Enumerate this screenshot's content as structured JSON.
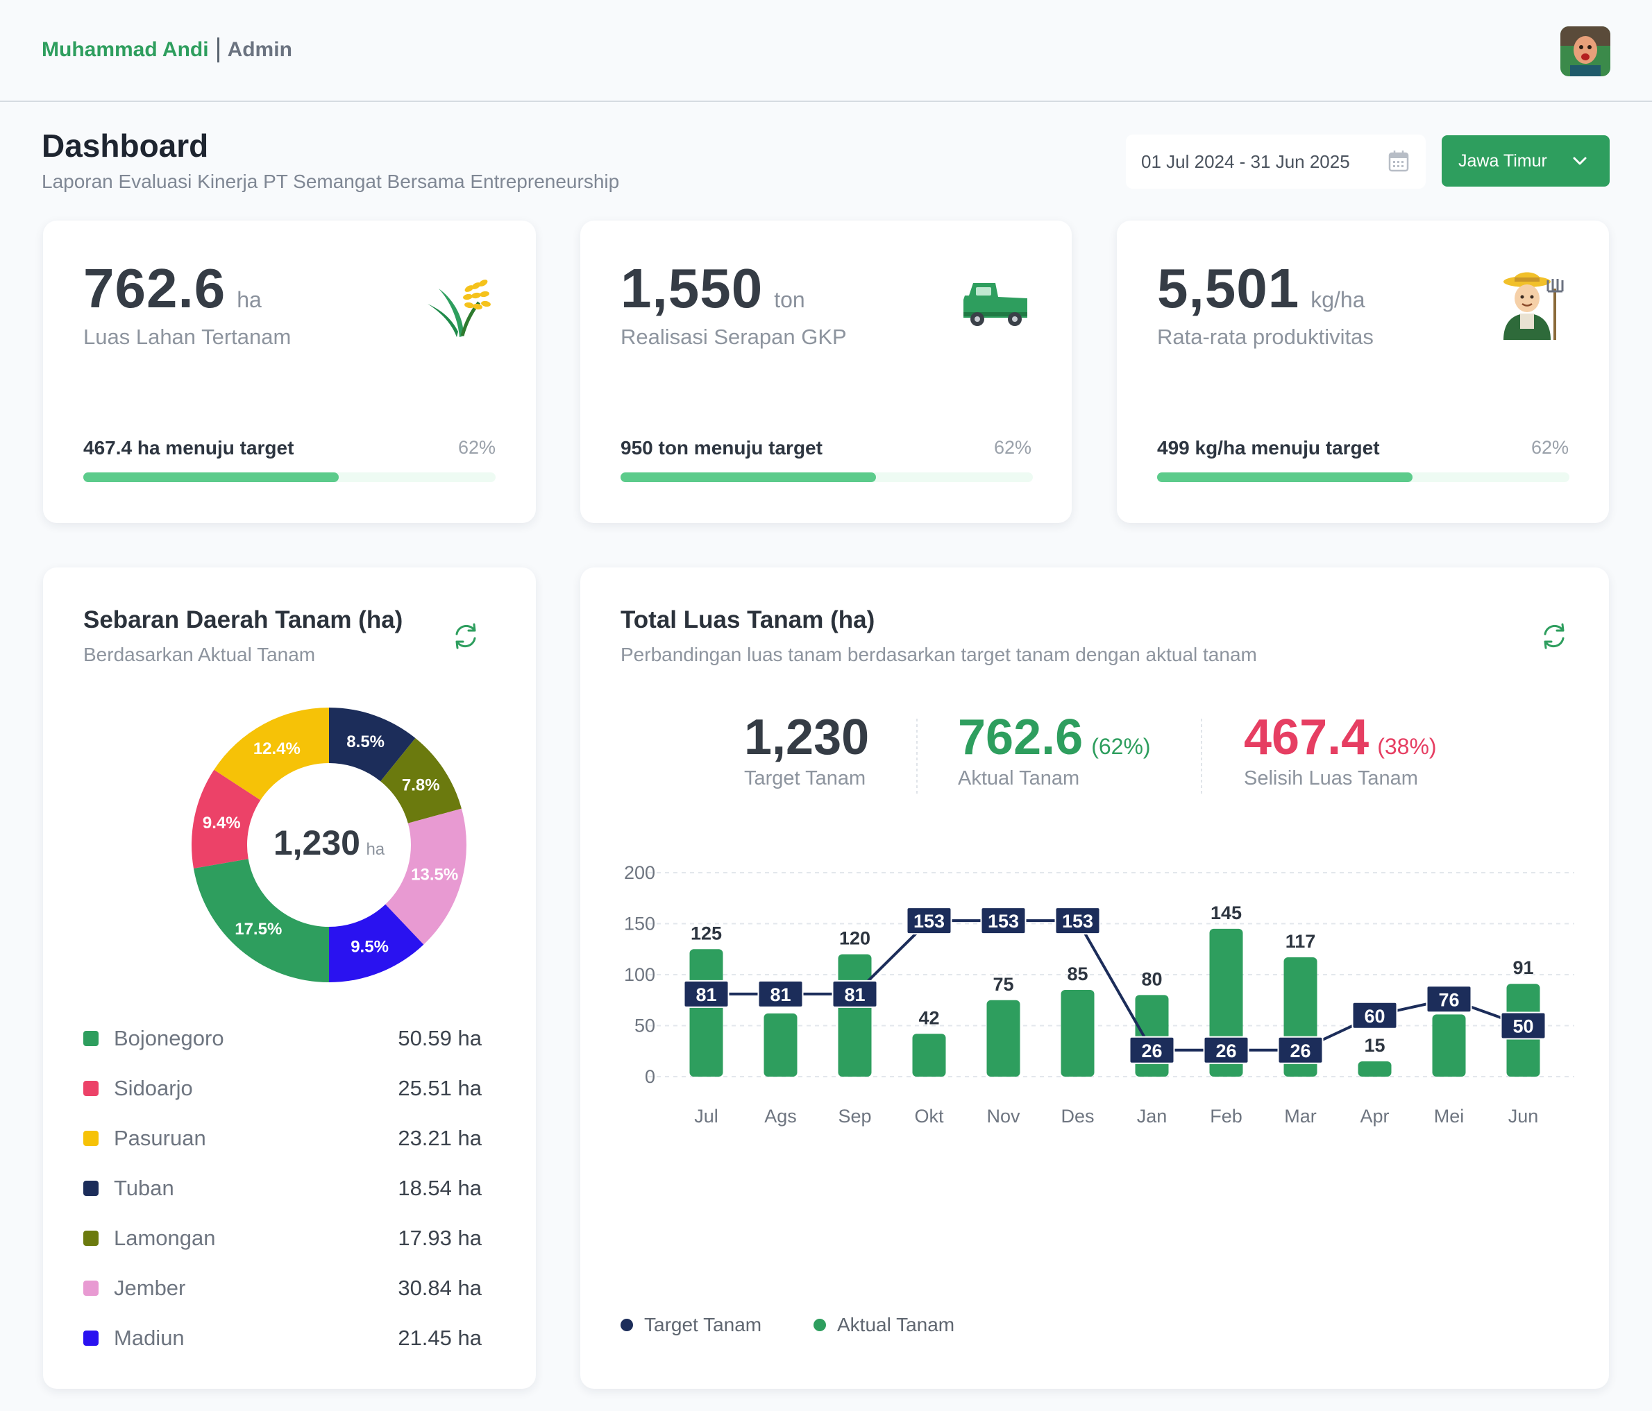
{
  "header": {
    "user_name": "Muhammad Andi",
    "role": "Admin"
  },
  "page": {
    "title": "Dashboard",
    "subtitle": "Laporan Evaluasi Kinerja PT Semangat Bersama Entrepreneurship"
  },
  "filters": {
    "date_range": "01 Jul 2024 - 31 Jun 2025",
    "region": "Jawa Timur"
  },
  "kpis": [
    {
      "value": "762.6",
      "unit": "ha",
      "label": "Luas Lahan Tertanam",
      "progress_text": "467.4 ha menuju target",
      "percent": "62%",
      "progress": 0.62,
      "icon": "rice-plant-icon"
    },
    {
      "value": "1,550",
      "unit": "ton",
      "label": "Realisasi Serapan GKP",
      "progress_text": "950 ton menuju target",
      "percent": "62%",
      "progress": 0.62,
      "icon": "pickup-truck-icon"
    },
    {
      "value": "5,501",
      "unit": "kg/ha",
      "label": "Rata-rata produktivitas",
      "progress_text": "499 kg/ha menuju target",
      "percent": "62%",
      "progress": 0.62,
      "icon": "farmer-icon"
    }
  ],
  "distribution": {
    "title": "Sebaran Daerah Tanam (ha)",
    "subtitle": "Berdasarkan Aktual Tanam",
    "center_value": "1,230",
    "center_unit": "ha",
    "items": [
      {
        "name": "Bojonegoro",
        "value": "50.59 ha",
        "color": "#2e9e5e"
      },
      {
        "name": "Sidoarjo",
        "value": "25.51 ha",
        "color": "#ec4268"
      },
      {
        "name": "Pasuruan",
        "value": "23.21 ha",
        "color": "#f6c207"
      },
      {
        "name": "Tuban",
        "value": "18.54 ha",
        "color": "#1c2d5a"
      },
      {
        "name": "Lamongan",
        "value": "17.93 ha",
        "color": "#6b7a0e"
      },
      {
        "name": "Jember",
        "value": "30.84 ha",
        "color": "#e89ad2"
      },
      {
        "name": "Madiun",
        "value": "21.45 ha",
        "color": "#2a12f0"
      }
    ]
  },
  "chart_data": [
    {
      "type": "pie",
      "style": "donut",
      "slices": [
        {
          "label": "8.5%",
          "value": 8.5,
          "color": "#1c2d5a"
        },
        {
          "label": "7.8%",
          "value": 7.8,
          "color": "#6b7a0e"
        },
        {
          "label": "13.5%",
          "value": 13.5,
          "color": "#e89ad2"
        },
        {
          "label": "9.5%",
          "value": 9.5,
          "color": "#2a12f0"
        },
        {
          "label": "17.5%",
          "value": 17.5,
          "color": "#2e9e5e"
        },
        {
          "label": "9.4%",
          "value": 9.4,
          "color": "#ec4268"
        },
        {
          "label": "12.4%",
          "value": 12.4,
          "color": "#f6c207"
        }
      ]
    },
    {
      "type": "bar",
      "categories": [
        "Jul",
        "Ags",
        "Sep",
        "Okt",
        "Nov",
        "Des",
        "Jan",
        "Feb",
        "Mar",
        "Apr",
        "Mei",
        "Jun"
      ],
      "series": [
        {
          "name": "Aktual Tanam",
          "type": "bar",
          "color": "#2e9e5e",
          "values": [
            125,
            62,
            120,
            42,
            75,
            85,
            80,
            145,
            117,
            15,
            61,
            91
          ]
        },
        {
          "name": "Target Tanam",
          "type": "line",
          "color": "#1c2d5a",
          "values": [
            81,
            81,
            81,
            153,
            153,
            153,
            26,
            26,
            26,
            60,
            76,
            50
          ]
        }
      ],
      "ylim": [
        0,
        200
      ],
      "yticks": [
        0,
        50,
        100,
        150,
        200
      ],
      "grid": true,
      "legend": "bottom-left"
    }
  ],
  "total": {
    "title": "Total Luas Tanam (ha)",
    "subtitle": "Perbandingan luas tanam berdasarkan target tanam dengan aktual tanam",
    "target_value": "1,230",
    "target_label": "Target Tanam",
    "actual_value": "762.6",
    "actual_pct": "(62%)",
    "actual_label": "Aktual Tanam",
    "diff_value": "467.4",
    "diff_pct": "(38%)",
    "diff_label": "Selisih Luas Tanam",
    "legend_target": "Target Tanam",
    "legend_actual": "Aktual Tanam"
  },
  "colors": {
    "brand_green": "#2e9e5e",
    "navy": "#1c2d5a",
    "red": "#e63e62"
  }
}
